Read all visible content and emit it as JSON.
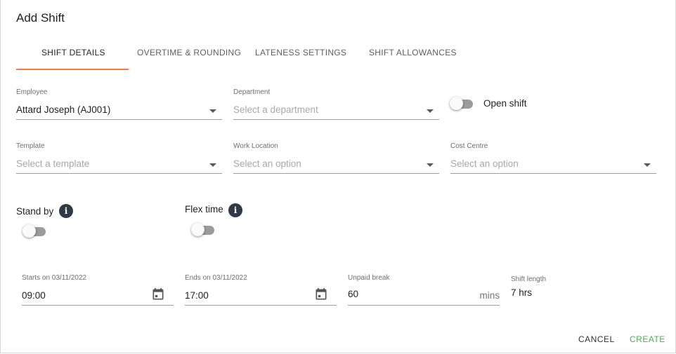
{
  "dialog": {
    "title": "Add Shift"
  },
  "tabs": [
    {
      "label": "SHIFT DETAILS",
      "active": true
    },
    {
      "label": "OVERTIME & ROUNDING",
      "active": false
    },
    {
      "label": "LATENESS SETTINGS",
      "active": false
    },
    {
      "label": "SHIFT ALLOWANCES",
      "active": false
    }
  ],
  "fields": {
    "employee": {
      "label": "Employee",
      "value": "Attard Joseph (AJ001)"
    },
    "department": {
      "label": "Department",
      "placeholder": "Select a department"
    },
    "open_shift": {
      "label": "Open shift",
      "checked": false
    },
    "template": {
      "label": "Template",
      "placeholder": "Select a template"
    },
    "work_location": {
      "label": "Work Location",
      "placeholder": "Select an option"
    },
    "cost_centre": {
      "label": "Cost Centre",
      "placeholder": "Select an option"
    },
    "stand_by": {
      "label": "Stand by",
      "checked": false
    },
    "flex_time": {
      "label": "Flex time",
      "checked": false
    },
    "starts_on": {
      "label": "Starts on 03/11/2022",
      "value": "09:00"
    },
    "ends_on": {
      "label": "Ends on 03/11/2022",
      "value": "17:00"
    },
    "unpaid_break": {
      "label": "Unpaid break",
      "value": "60",
      "suffix": "mins"
    },
    "shift_length": {
      "label": "Shift length",
      "value": "7 hrs"
    }
  },
  "actions": {
    "cancel": "CANCEL",
    "create": "CREATE"
  },
  "colors": {
    "tab_indicator": "#ef7f4a",
    "create_button": "#4caf50",
    "info_icon_bg": "#2f3a45"
  },
  "icons": {
    "info": "info-icon",
    "calendar": "calendar-icon",
    "dropdown": "chevron-down-icon"
  }
}
